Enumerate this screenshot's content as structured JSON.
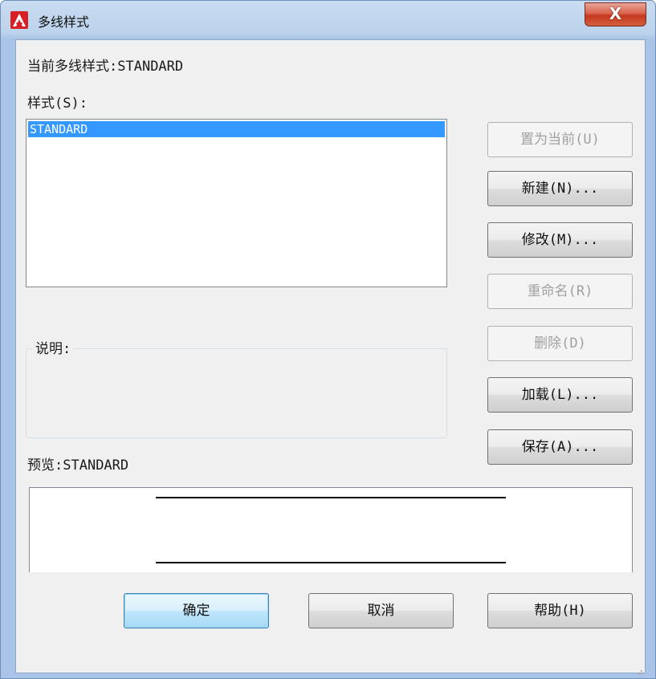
{
  "window": {
    "title": "多线样式",
    "close_label": "X"
  },
  "current_style": {
    "label": "当前多线样式:",
    "value": "STANDARD"
  },
  "styles_list": {
    "label": "样式(S):",
    "items": [
      "STANDARD"
    ],
    "selected_index": 0
  },
  "buttons": {
    "set_current": "置为当前(U)",
    "new": "新建(N)...",
    "modify": "修改(M)...",
    "rename": "重命名(R)",
    "delete": "删除(D)",
    "load": "加载(L)...",
    "save": "保存(A)..."
  },
  "description": {
    "label": "说明:",
    "text": ""
  },
  "preview": {
    "label": "预览:",
    "value": "STANDARD"
  },
  "footer": {
    "ok": "确定",
    "cancel": "取消",
    "help": "帮助(H)"
  },
  "colors": {
    "selection": "#3399ff",
    "close_button": "#c5381f",
    "app_icon": "#d81f26"
  }
}
